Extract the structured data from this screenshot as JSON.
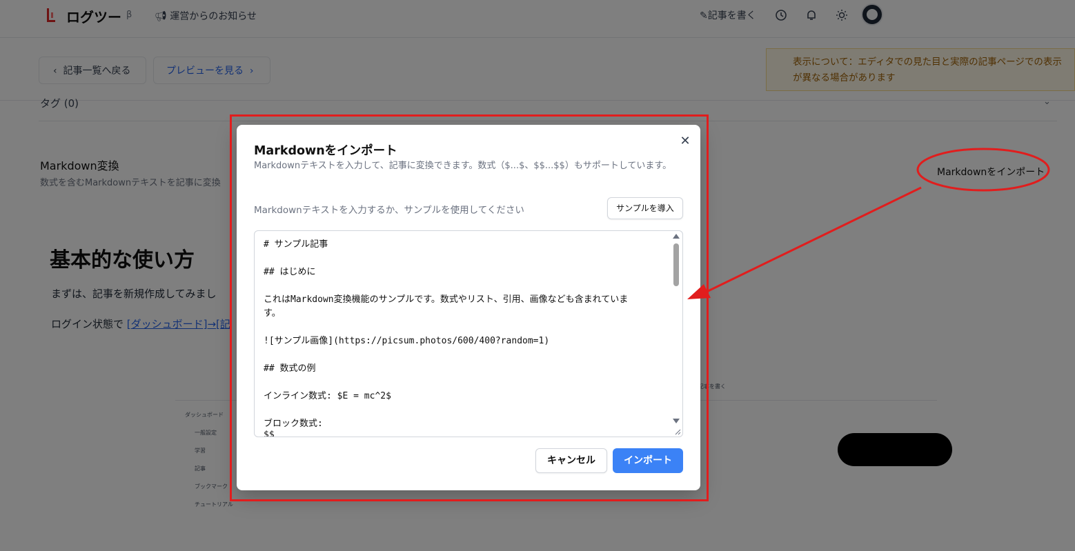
{
  "header": {
    "app_name": "ログツー",
    "beta_label": "β",
    "news_link": "運営からのお知らせ",
    "write_label": "記事を書く"
  },
  "toolbar": {
    "back_label": "記事一覧へ戻る",
    "preview_label": "プレビューを見る",
    "notice_text": "表示について：エディタでの見た目と実際の記事ページでの表示が異なる場合があります"
  },
  "settings": {
    "tag_row": "タグ (0)",
    "markdown_title": "Markdown変換",
    "markdown_desc": "数式を含むMarkdownテキストを記事に変換",
    "import_link": "Markdownをインポート"
  },
  "article": {
    "heading": "基本的な使い方",
    "para1": "まずは、記事を新規作成してみまし",
    "para2_prefix": "ログイン状態で ",
    "para2_link": "[ダッシュボード]→[記"
  },
  "embedded_screenshot": {
    "top_bar": "記事を書く",
    "sidebar": [
      "ダッシュボード",
      "一般設定",
      "学習",
      "記事",
      "ブックマーク",
      "チュートリアル"
    ]
  },
  "dialog": {
    "title": "Markdownをインポート",
    "description": "Markdownテキストを入力して、記事に変換できます。数式（$...$、$$...$$）もサポートしています。",
    "hint": "Markdownテキストを入力するか、サンプルを使用してください",
    "sample_button": "サンプルを導入",
    "textarea_lines": [
      "# サンプル記事",
      "",
      "## はじめに",
      "",
      "これはMarkdown変換機能のサンプルです。数式やリスト、引用、画像なども含まれていま",
      "す。",
      "",
      "![サンプル画像](https://picsum.photos/600/400?random=1)",
      "",
      "## 数式の例",
      "",
      "インライン数式: $E = mc^2$",
      "",
      "ブロック数式:",
      "$$"
    ],
    "cancel_button": "キャンセル",
    "import_button": "インポート"
  },
  "colors": {
    "accent": "#3b82f6",
    "annotation_red": "#e11d1d",
    "notice_bg": "#fff8e6",
    "notice_text": "#a16207"
  }
}
